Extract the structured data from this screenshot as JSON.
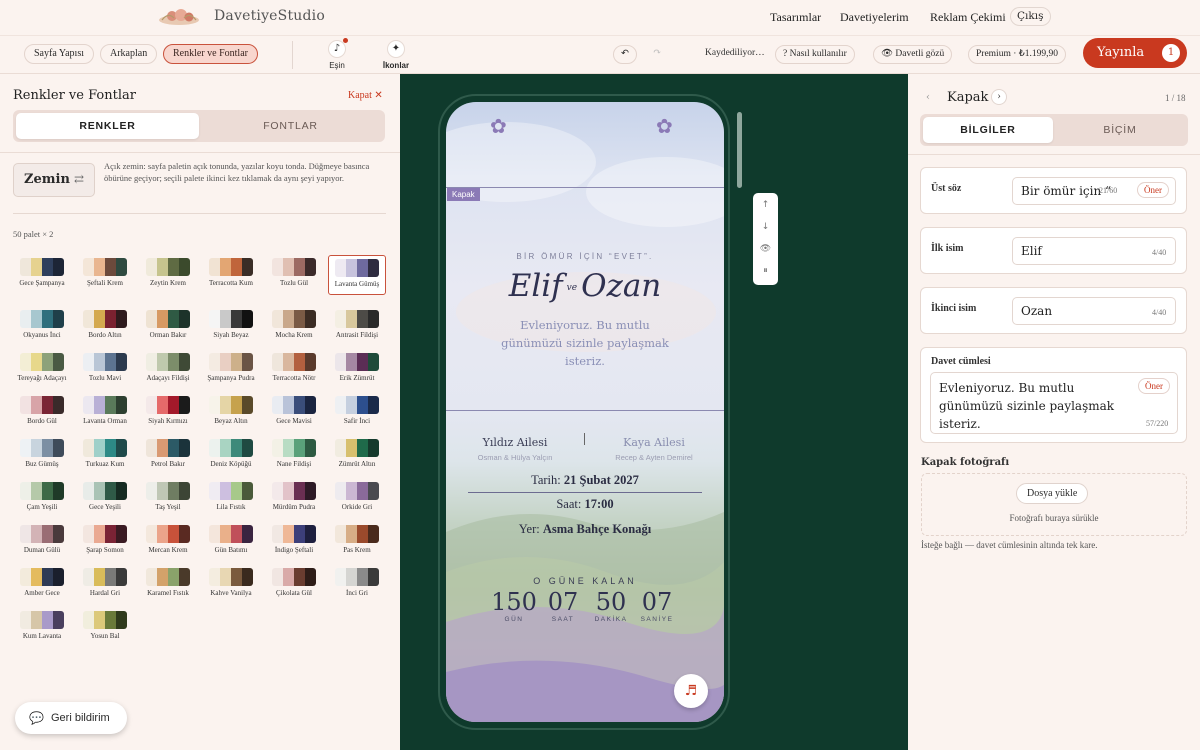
{
  "header": {
    "logo_text": "DavetiyeStudio",
    "nav": [
      "Tasarımlar",
      "Davetiyelerim",
      "Reklam Çekimi"
    ],
    "logout": "Çıkış"
  },
  "toolbar": {
    "section_pills": [
      "Sayfa Yapısı",
      "Arkaplan",
      "Renkler ve Fontlar"
    ],
    "active_pill": "Renkler ve Fontlar",
    "tools": [
      {
        "label": "Eşin",
        "icon": "music-note-icon"
      },
      {
        "label": "İkonlar",
        "icon": "sparkle-icon"
      }
    ],
    "undo_icon": "↶",
    "redo_icon": "↷",
    "save_status": "Kaydediliyor…",
    "help": "? Nasıl kullanılır",
    "guest_view": "👁 Davetli gözü",
    "premium": "Premium · ₺1.199,90",
    "publish": "Yayınla",
    "publish_badge": "1"
  },
  "left_panel": {
    "title": "Renkler ve Fontlar",
    "close": "Kapat ✕",
    "tabs": [
      "RENKLER",
      "FONTLAR"
    ],
    "zemin_label": "Zemin",
    "zemin_icon": "⇄",
    "zemin_desc": "Açık zemin: sayfa paletin açık tonunda, yazılar koyu tonda. Düğmeye basınca öbürüne geçiyor; seçili palete ikinci kez tıklamak da aynı şeyi yapıyor.",
    "palette_count": "50 palet × 2",
    "selected_palette": "Lavanta Gümüş",
    "palettes": [
      {
        "name": "Gece Şampanya",
        "colors": [
          "#efe7db",
          "#e6d28f",
          "#2f3f5c",
          "#1d2536"
        ]
      },
      {
        "name": "Şeftali Krem",
        "colors": [
          "#f4e6d8",
          "#e9b690",
          "#6c4a3c",
          "#2f4a40"
        ]
      },
      {
        "name": "Zeytin Krem",
        "colors": [
          "#f0eadb",
          "#c6c48e",
          "#5f6b43",
          "#3b4a2c"
        ]
      },
      {
        "name": "Terracotta Kum",
        "colors": [
          "#f1e3d3",
          "#e3a673",
          "#c0653b",
          "#3a2d26"
        ]
      },
      {
        "name": "Tozlu Gül",
        "colors": [
          "#f2e4df",
          "#e0bfb2",
          "#9c6a63",
          "#3b2a2a"
        ]
      },
      {
        "name": "Lavanta Gümüş",
        "colors": [
          "#eeeaf2",
          "#c7c3dd",
          "#6e6a9e",
          "#2e2c40"
        ]
      },
      {
        "name": "Okyanus İnci",
        "colors": [
          "#e9eef0",
          "#a7c7cf",
          "#2f6f7d",
          "#1f3f4a"
        ]
      },
      {
        "name": "Bordo Altın",
        "colors": [
          "#f1e7d9",
          "#d4a94f",
          "#7a2130",
          "#2e1a1d"
        ]
      },
      {
        "name": "Orman Bakır",
        "colors": [
          "#efe3d3",
          "#d79a63",
          "#2f5a44",
          "#1d332a"
        ]
      },
      {
        "name": "Siyah Beyaz",
        "colors": [
          "#f5f5f5",
          "#c9c9c9",
          "#3a3a3a",
          "#111111"
        ]
      },
      {
        "name": "Mocha Krem",
        "colors": [
          "#f1e6da",
          "#c9a88b",
          "#7a5a45",
          "#3b2c24"
        ]
      },
      {
        "name": "Antrasit Fildişi",
        "colors": [
          "#f4efe3",
          "#d8c89d",
          "#4d4b47",
          "#2a2a2a"
        ]
      },
      {
        "name": "Tereyağı Adaçayı",
        "colors": [
          "#f3eed5",
          "#e7d88b",
          "#8da27a",
          "#4a5a44"
        ]
      },
      {
        "name": "Tozlu Mavi",
        "colors": [
          "#eceff3",
          "#b9c6d6",
          "#5d7491",
          "#2c3a4e"
        ]
      },
      {
        "name": "Adaçayı Fildişi",
        "colors": [
          "#f0eee3",
          "#bfc9ad",
          "#7c8d6a",
          "#3f4a36"
        ]
      },
      {
        "name": "Şampanya Pudra",
        "colors": [
          "#f4ebe2",
          "#e9cfc3",
          "#cdb08a",
          "#6a5445"
        ]
      },
      {
        "name": "Terracotta Nötr",
        "colors": [
          "#efe6dc",
          "#d9b79e",
          "#b3603f",
          "#5a3a2c"
        ]
      },
      {
        "name": "Erik Zümrüt",
        "colors": [
          "#ece6ea",
          "#a588a3",
          "#5b2d55",
          "#1f4b3a"
        ]
      },
      {
        "name": "Bordo Gül",
        "colors": [
          "#f2e2e2",
          "#d8a4a8",
          "#7a2535",
          "#3a2a2a"
        ]
      },
      {
        "name": "Lavanta Orman",
        "colors": [
          "#ece8f0",
          "#b9b0d6",
          "#5a7a5a",
          "#2d3f30"
        ]
      },
      {
        "name": "Siyah Kırmızı",
        "colors": [
          "#f4e9e9",
          "#e56a6a",
          "#a3192a",
          "#1b1b1b"
        ]
      },
      {
        "name": "Beyaz Altın",
        "colors": [
          "#f7f3ea",
          "#e5d5a6",
          "#c6a24d",
          "#5a4a2a"
        ]
      },
      {
        "name": "Gece Mavisi",
        "colors": [
          "#e9ecf2",
          "#b9c3d9",
          "#3a4d7a",
          "#1a2440"
        ]
      },
      {
        "name": "Safir İnci",
        "colors": [
          "#eef0f3",
          "#c5cfdf",
          "#2d4f8e",
          "#1a2a4a"
        ]
      },
      {
        "name": "Buz Gümüş",
        "colors": [
          "#eef2f5",
          "#c8d4de",
          "#7c8fa3",
          "#3e4b5a"
        ]
      },
      {
        "name": "Turkuaz Kum",
        "colors": [
          "#f0e9dc",
          "#9fd0c9",
          "#2d8a86",
          "#1f4a4a"
        ]
      },
      {
        "name": "Petrol Bakır",
        "colors": [
          "#efe5da",
          "#d99a73",
          "#2c5a66",
          "#1b333b"
        ]
      },
      {
        "name": "Deniz Köpüğü",
        "colors": [
          "#ecf2ee",
          "#a9d4c2",
          "#3d8a7a",
          "#1f4a42"
        ]
      },
      {
        "name": "Nane Fildişi",
        "colors": [
          "#f3f1e6",
          "#b8dcc3",
          "#5aa17a",
          "#2d5a42"
        ]
      },
      {
        "name": "Zümrüt Altın",
        "colors": [
          "#f1ece0",
          "#d7c06e",
          "#1f6a4a",
          "#153a2c"
        ]
      },
      {
        "name": "Çam Yeşili",
        "colors": [
          "#eef0e8",
          "#b5c9a9",
          "#3d6a47",
          "#1f3a28"
        ]
      },
      {
        "name": "Gece Yeşili",
        "colors": [
          "#e8ece9",
          "#a9c3b5",
          "#2f5a47",
          "#162b22"
        ]
      },
      {
        "name": "Taş Yeşil",
        "colors": [
          "#edeee9",
          "#bfc7b5",
          "#6f7d62",
          "#3d4535"
        ]
      },
      {
        "name": "Lila Fıstık",
        "colors": [
          "#f0ecf2",
          "#cdbfe0",
          "#a7c98a",
          "#4a5a3a"
        ]
      },
      {
        "name": "Mürdüm Pudra",
        "colors": [
          "#f3e9ea",
          "#e2c3c9",
          "#6a2f52",
          "#2d1a26"
        ]
      },
      {
        "name": "Orkide Gri",
        "colors": [
          "#eeebef",
          "#cbb7d3",
          "#8a6a9a",
          "#4a4a50"
        ]
      },
      {
        "name": "Duman Gülü",
        "colors": [
          "#efe6e6",
          "#d3b3b6",
          "#9a6d74",
          "#4a3a3c"
        ]
      },
      {
        "name": "Şarap Somon",
        "colors": [
          "#f3e6e0",
          "#eaa992",
          "#7a2335",
          "#3a1a22"
        ]
      },
      {
        "name": "Mercan Krem",
        "colors": [
          "#f4e8dd",
          "#eba48a",
          "#c8523a",
          "#5a2a22"
        ]
      },
      {
        "name": "Gün Batımı",
        "colors": [
          "#f4e6dc",
          "#eab08a",
          "#c0505a",
          "#3a2440"
        ]
      },
      {
        "name": "İndigo Şeftali",
        "colors": [
          "#f1e8e3",
          "#efb897",
          "#3d3f7a",
          "#1e1f3e"
        ]
      },
      {
        "name": "Pas Krem",
        "colors": [
          "#f2e7db",
          "#d7ad86",
          "#9a4a2c",
          "#4a2a1c"
        ]
      },
      {
        "name": "Amber Gece",
        "colors": [
          "#f3ebdc",
          "#e4bb5e",
          "#2f3b55",
          "#1a1f2d"
        ]
      },
      {
        "name": "Hardal Gri",
        "colors": [
          "#efece5",
          "#d9bc5a",
          "#7a7a78",
          "#3a3a3a"
        ]
      },
      {
        "name": "Karamel Fıstık",
        "colors": [
          "#f1e8dc",
          "#d3a26a",
          "#8aa26a",
          "#4a3a2a"
        ]
      },
      {
        "name": "Kahve Vanilya",
        "colors": [
          "#f4ede0",
          "#e8d7b3",
          "#7a5a3d",
          "#3a2a1e"
        ]
      },
      {
        "name": "Çikolata Gül",
        "colors": [
          "#f1e6e2",
          "#d9aaa8",
          "#6a3d30",
          "#2e1d18"
        ]
      },
      {
        "name": "İnci Gri",
        "colors": [
          "#f1f1ef",
          "#d5d5d2",
          "#8a8a8a",
          "#3a3a3a"
        ]
      },
      {
        "name": "Kum Lavanta",
        "colors": [
          "#f1ebe1",
          "#d6c6a8",
          "#a99ac9",
          "#4a3f5e"
        ]
      },
      {
        "name": "Yosun Bal",
        "colors": [
          "#f1eedd",
          "#dcc97a",
          "#6a7a3a",
          "#2f3a1c"
        ]
      }
    ],
    "feedback": "Geri bildirim",
    "feedback_icon": "💬"
  },
  "preview": {
    "tag": "Kapak",
    "ust_soz": "BİR ÖMÜR İÇİN “EVET”.",
    "name1": "Elif",
    "ve": "ve",
    "name2": "Ozan",
    "davet": "Evleniyoruz. Bu mutlu günümüzü sizinle paylaşmak isteriz.",
    "family1": {
      "name": "Yıldız Ailesi",
      "sub": "Osman & Hülya Yalçın"
    },
    "family2": {
      "name": "Kaya Ailesi",
      "sub": "Recep & Ayten Demirel"
    },
    "date_label": "Tarih:",
    "date": "21 Şubat 2027",
    "time_label": "Saat:",
    "time": "17:00",
    "venue_label": "Yer:",
    "venue": "Asma Bahçe Konağı",
    "countdown_title": "O GÜNE KALAN",
    "countdown": [
      {
        "n": "150",
        "u": "GÜN"
      },
      {
        "n": "07",
        "u": "SAAT"
      },
      {
        "n": "50",
        "u": "DAKİKA"
      },
      {
        "n": "07",
        "u": "SANİYE"
      }
    ],
    "side_tools": [
      "↑",
      "↓",
      "👁",
      "⏸"
    ],
    "music_icon": "♬"
  },
  "right_panel": {
    "title": "Kapak",
    "page_count": "1 / 18",
    "tabs": [
      "BİLGİLER",
      "BİÇİM"
    ],
    "fields": {
      "ust_soz": {
        "label": "Üst söz",
        "value": "Bir ömür için “",
        "count": "21/60",
        "button": "Öner"
      },
      "ilk_isim": {
        "label": "İlk isim",
        "value": "Elif",
        "count": "4/40"
      },
      "ikinci_isim": {
        "label": "İkinci isim",
        "value": "Ozan",
        "count": "4/40"
      },
      "davet": {
        "label": "Davet cümlesi",
        "value": "Evleniyoruz. Bu mutlu günümüzü sizinle paylaşmak isteriz.",
        "count": "57/220",
        "button": "Öner"
      }
    },
    "kapak_foto_label": "Kapak fotoğrafı",
    "upload": "Dosya yükle",
    "drop_text": "Fotoğrafı buraya sürükle",
    "optional": "İsteğe bağlı — davet cümlesinin altında tek kare."
  }
}
